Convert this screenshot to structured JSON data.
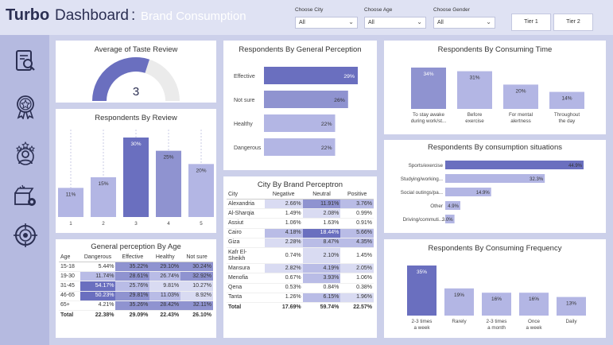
{
  "header": {
    "brand": "Turbo",
    "title": "Dashboard",
    "colon": ":",
    "subtitle": "Brand Consumption",
    "filters": [
      {
        "label": "Choose City",
        "value": "All"
      },
      {
        "label": "Choose Age",
        "value": "All"
      },
      {
        "label": "Choose Gender",
        "value": "All"
      }
    ],
    "tiers": [
      "Tier 1",
      "Tier 2"
    ]
  },
  "sidebar": {
    "icons": [
      "report-search-icon",
      "award-badge-icon",
      "people-stars-icon",
      "box-settings-icon",
      "target-icon"
    ]
  },
  "gauge": {
    "title": "Average of Taste Review",
    "value": "3",
    "fill_fraction": 0.6
  },
  "review": {
    "title": "Respondents By Review",
    "categories": [
      "1",
      "2",
      "3",
      "4",
      "5"
    ],
    "values": [
      11,
      15,
      30,
      25,
      20
    ],
    "labels": [
      "11%",
      "15%",
      "30%",
      "25%",
      "20%"
    ]
  },
  "perception": {
    "title": "Respondents By General Perception",
    "categories": [
      "Effective",
      "Not sure",
      "Healthy",
      "Dangerous"
    ],
    "values": [
      29,
      26,
      22,
      22
    ],
    "labels": [
      "29%",
      "26%",
      "22%",
      "22%"
    ]
  },
  "consuming_time": {
    "title": "Respondents By Consuming Time",
    "categories": [
      "To stay awake during work/st...",
      "Before exercise",
      "For mental alertness",
      "Throughout the day"
    ],
    "values": [
      34,
      31,
      20,
      14
    ],
    "labels": [
      "34%",
      "31%",
      "20%",
      "14%"
    ]
  },
  "situations": {
    "title": "Respondents By consumption situations",
    "categories": [
      "Sports/exercise",
      "Studying/working...",
      "Social outings/pa...",
      "Other",
      "Driving/commuti..."
    ],
    "values": [
      44.9,
      32.3,
      14.9,
      4.9,
      3.0
    ],
    "labels": [
      "44.9%",
      "32.3%",
      "14.9%",
      "4.9%",
      "3.0%"
    ]
  },
  "frequency": {
    "title": "Respondents By Consuming Frequency",
    "categories": [
      "2-3 times a week",
      "Rarely",
      "2-3 times a month",
      "Once a week",
      "Daily"
    ],
    "values": [
      35,
      19,
      16,
      16,
      13
    ],
    "labels": [
      "35%",
      "19%",
      "16%",
      "16%",
      "13%"
    ]
  },
  "age_table": {
    "title": "General perception By Age",
    "headers": [
      "Age",
      "Dangerous",
      "Effective",
      "Healthy",
      "Not sure"
    ],
    "rows": [
      [
        "15-18",
        "5.44%",
        "35.22%",
        "29.10%",
        "30.24%"
      ],
      [
        "19-30",
        "11.74%",
        "28.61%",
        "26.74%",
        "32.92%"
      ],
      [
        "31-45",
        "54.17%",
        "25.76%",
        "9.81%",
        "10.27%"
      ],
      [
        "46-65",
        "50.23%",
        "29.81%",
        "11.03%",
        "8.92%"
      ],
      [
        "65+",
        "4.21%",
        "35.26%",
        "28.42%",
        "32.11%"
      ]
    ],
    "total": [
      "Total",
      "22.38%",
      "29.09%",
      "22.43%",
      "26.10%"
    ]
  },
  "city_table": {
    "title": "City By Brand Perceptron",
    "headers": [
      "City",
      "Negative",
      "Neutral",
      "Positive"
    ],
    "rows": [
      [
        "Alexandria",
        "2.66%",
        "11.91%",
        "3.76%"
      ],
      [
        "Al-Sharqia",
        "1.49%",
        "2.08%",
        "0.99%"
      ],
      [
        "Assiut",
        "1.06%",
        "1.63%",
        "0.91%"
      ],
      [
        "Cairo",
        "4.18%",
        "18.44%",
        "5.66%"
      ],
      [
        "Giza",
        "2.28%",
        "8.47%",
        "4.35%"
      ],
      [
        "Kafr El-Sheikh",
        "0.74%",
        "2.10%",
        "1.45%"
      ],
      [
        "Mansura",
        "2.82%",
        "4.19%",
        "2.05%"
      ],
      [
        "Menofia",
        "0.67%",
        "3.93%",
        "1.06%"
      ],
      [
        "Qena",
        "0.53%",
        "0.84%",
        "0.38%"
      ],
      [
        "Tanta",
        "1.26%",
        "6.15%",
        "1.96%"
      ]
    ],
    "total": [
      "Total",
      "17.69%",
      "59.74%",
      "22.57%"
    ]
  },
  "colors": {
    "dark": "#6a6fbf",
    "mid": "#8f93d0",
    "light": "#b3b6e4",
    "pale": "#d9dbf2",
    "background": "#ccd0ea"
  }
}
